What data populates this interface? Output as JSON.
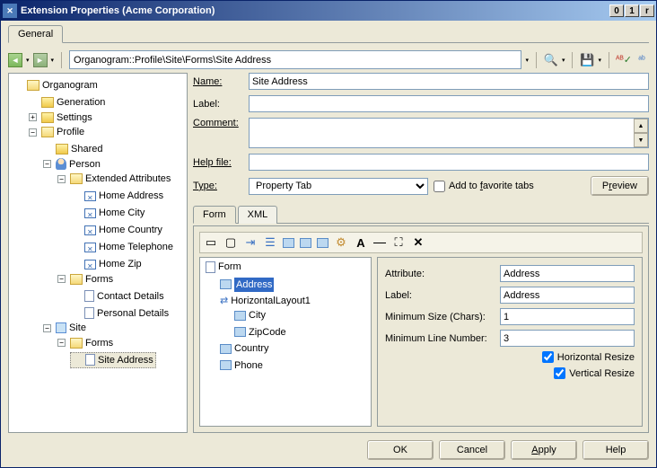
{
  "window": {
    "title": "Extension Properties (Acme Corporation)"
  },
  "main_tab": "General",
  "path": "Organogram::Profile\\Site\\Forms\\Site Address",
  "tree": {
    "root": "Organogram",
    "generation": "Generation",
    "settings": "Settings",
    "profile": "Profile",
    "shared": "Shared",
    "person": "Person",
    "ext_attr": "Extended Attributes",
    "home_addr": "Home Address",
    "home_city": "Home City",
    "home_country": "Home Country",
    "home_tel": "Home Telephone",
    "home_zip": "Home Zip",
    "forms": "Forms",
    "contact": "Contact Details",
    "personal": "Personal Details",
    "site": "Site",
    "forms2": "Forms",
    "site_addr": "Site Address"
  },
  "labels": {
    "name": "Name:",
    "label": "Label:",
    "comment": "Comment:",
    "help": "Help file:",
    "type": "Type:",
    "favorite": "Add to favorite tabs",
    "preview": "Preview"
  },
  "values": {
    "name": "Site Address",
    "label": "",
    "help": "",
    "type": "Property Tab"
  },
  "subtabs": {
    "form": "Form",
    "xml": "XML"
  },
  "form_tree": {
    "root": "Form",
    "address": "Address",
    "hlayout": "HorizontalLayout1",
    "city": "City",
    "zip": "ZipCode",
    "country": "Country",
    "phone": "Phone"
  },
  "props": {
    "attribute_l": "Attribute:",
    "attribute_v": "Address",
    "label_l": "Label:",
    "label_v": "Address",
    "minsize_l": "Minimum Size (Chars):",
    "minsize_v": "1",
    "minline_l": "Minimum Line Number:",
    "minline_v": "3",
    "hresize": "Horizontal Resize",
    "vresize": "Vertical Resize"
  },
  "footer": {
    "ok": "OK",
    "cancel": "Cancel",
    "apply": "Apply",
    "help": "Help"
  }
}
